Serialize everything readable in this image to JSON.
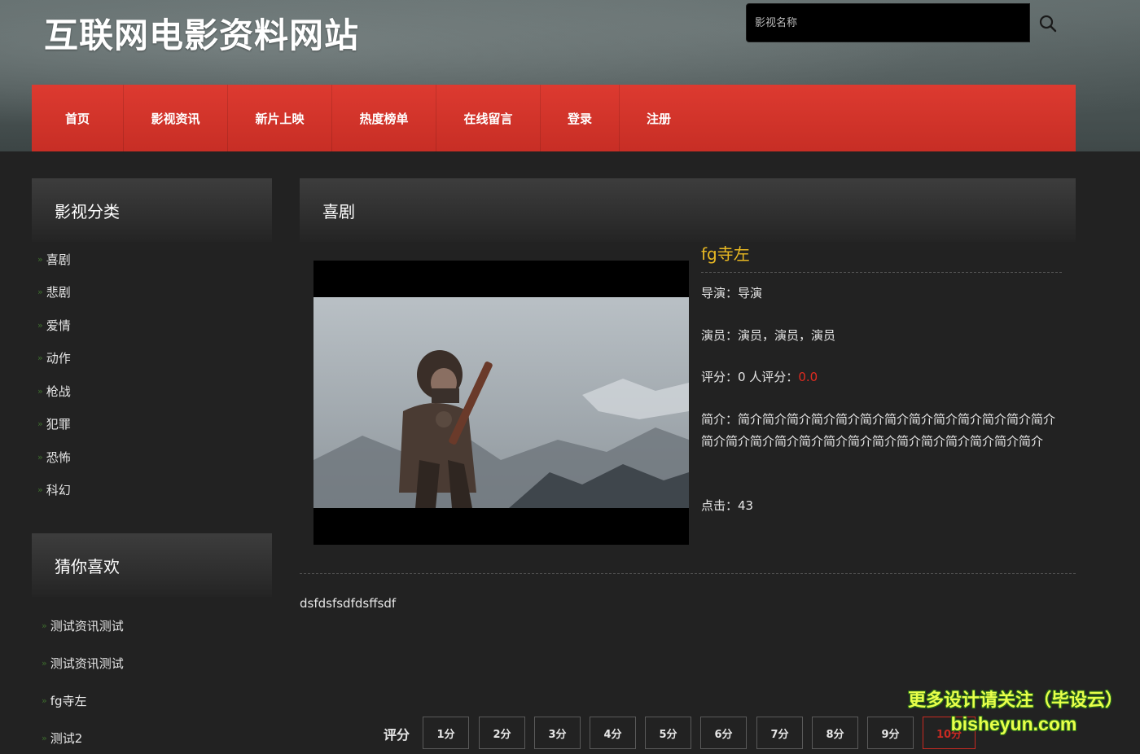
{
  "header": {
    "site_title": "互联网电影资料网站",
    "search_placeholder": "影视名称"
  },
  "nav": {
    "items": [
      "首页",
      "影视资讯",
      "新片上映",
      "热度榜单",
      "在线留言",
      "登录",
      "注册"
    ]
  },
  "sidebar": {
    "categories_title": "影视分类",
    "categories": [
      "喜剧",
      "悲剧",
      "爱情",
      "动作",
      "枪战",
      "犯罪",
      "恐怖",
      "科幻"
    ],
    "recommend_title": "猜你喜欢",
    "recommend": [
      "测试资讯测试",
      "测试资讯测试",
      "fg寺左",
      "测试2"
    ]
  },
  "main": {
    "category_title": "喜剧",
    "movie_title": "fg寺左",
    "director_line": "导演：导演",
    "actors_line": "演员：演员，演员，演员",
    "rating_prefix": "评分：0 人评分：",
    "rating_value": "0.0",
    "intro_line": "简介：简介简介简介简介简介简介简介简介简介简介简介简介简介简介简介简介简介简介简介简介简介简介简介简介简介简介简介",
    "clicks_line": "点击：43",
    "description": "dsfdsfsdfdsffsdf",
    "rate_label": "评分",
    "rate_buttons": [
      "1分",
      "2分",
      "3分",
      "4分",
      "5分",
      "6分",
      "7分",
      "8分",
      "9分",
      "10分"
    ]
  },
  "watermark": {
    "line1": "更多设计请关注（毕设云）",
    "line2": "bisheyun.com"
  },
  "colors": {
    "nav_red": "#d2342a",
    "title_gold": "#e8b822",
    "rating_red": "#e02b20",
    "bg_dark": "#222222"
  }
}
